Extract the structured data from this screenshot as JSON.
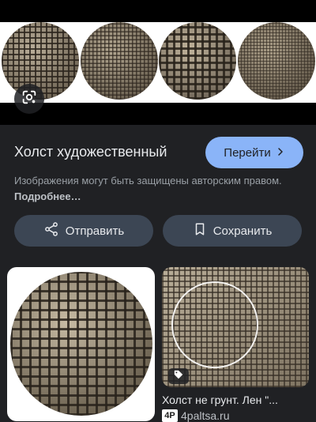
{
  "header": {
    "title": "Холст художественный",
    "visit_label": "Перейти"
  },
  "notice": {
    "text": "Изображения могут быть защищены авторским правом.",
    "more_link": "Подробнее…"
  },
  "actions": {
    "share_label": "Отправить",
    "save_label": "Сохранить"
  },
  "related": [
    {
      "caption": ""
    },
    {
      "caption": "Холст не грунт. Лен \"...",
      "source": "4paltsa.ru",
      "favicon": "4P"
    }
  ],
  "icons": {
    "lens": "google-lens-icon",
    "chevron": "chevron-right-icon",
    "share": "share-icon",
    "bookmark": "bookmark-icon",
    "tag": "tag-icon"
  },
  "colors": {
    "background": "#202124",
    "accent": "#8ab4f8",
    "button_bg": "#3c4654"
  }
}
